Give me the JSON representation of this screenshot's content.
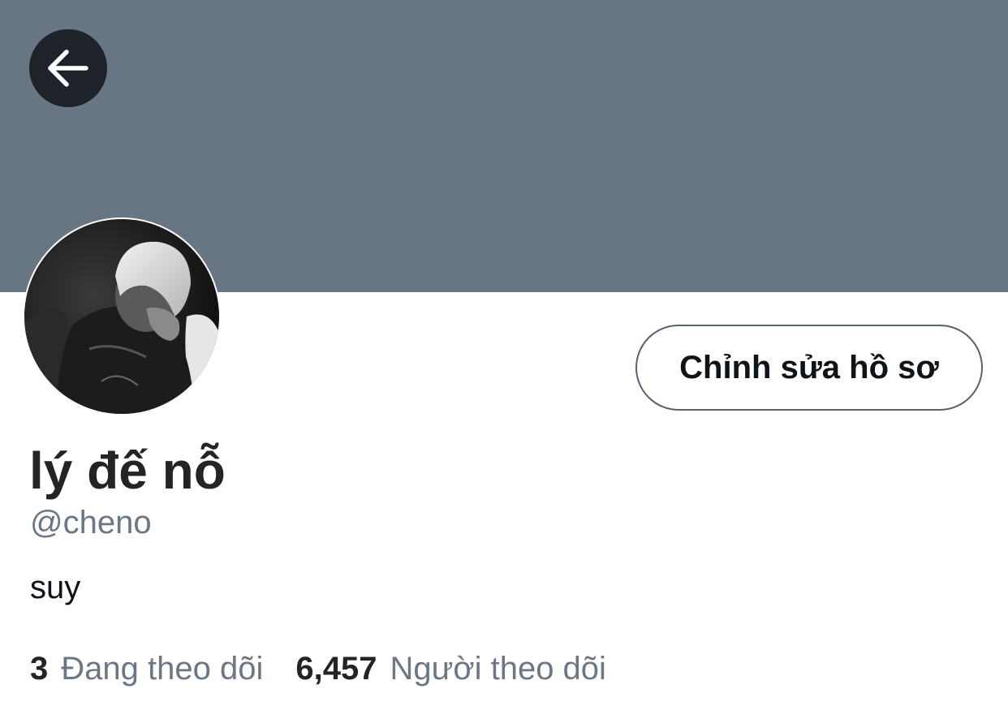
{
  "profile": {
    "back_icon": "arrow-left-icon",
    "avatar_icon": "profile-photo",
    "edit_button_label": "Chỉnh sửa hồ sơ",
    "display_name": "lý đế nỗ",
    "handle": "@cheno",
    "bio": "suy",
    "following_count": "3",
    "following_label": "Đang theo dõi",
    "followers_count": "6,457",
    "followers_label": "Người theo dõi"
  },
  "colors": {
    "banner": "#687684",
    "back_button": "#1e2329",
    "muted_text": "#6b7784",
    "primary_text": "#0f1419"
  }
}
